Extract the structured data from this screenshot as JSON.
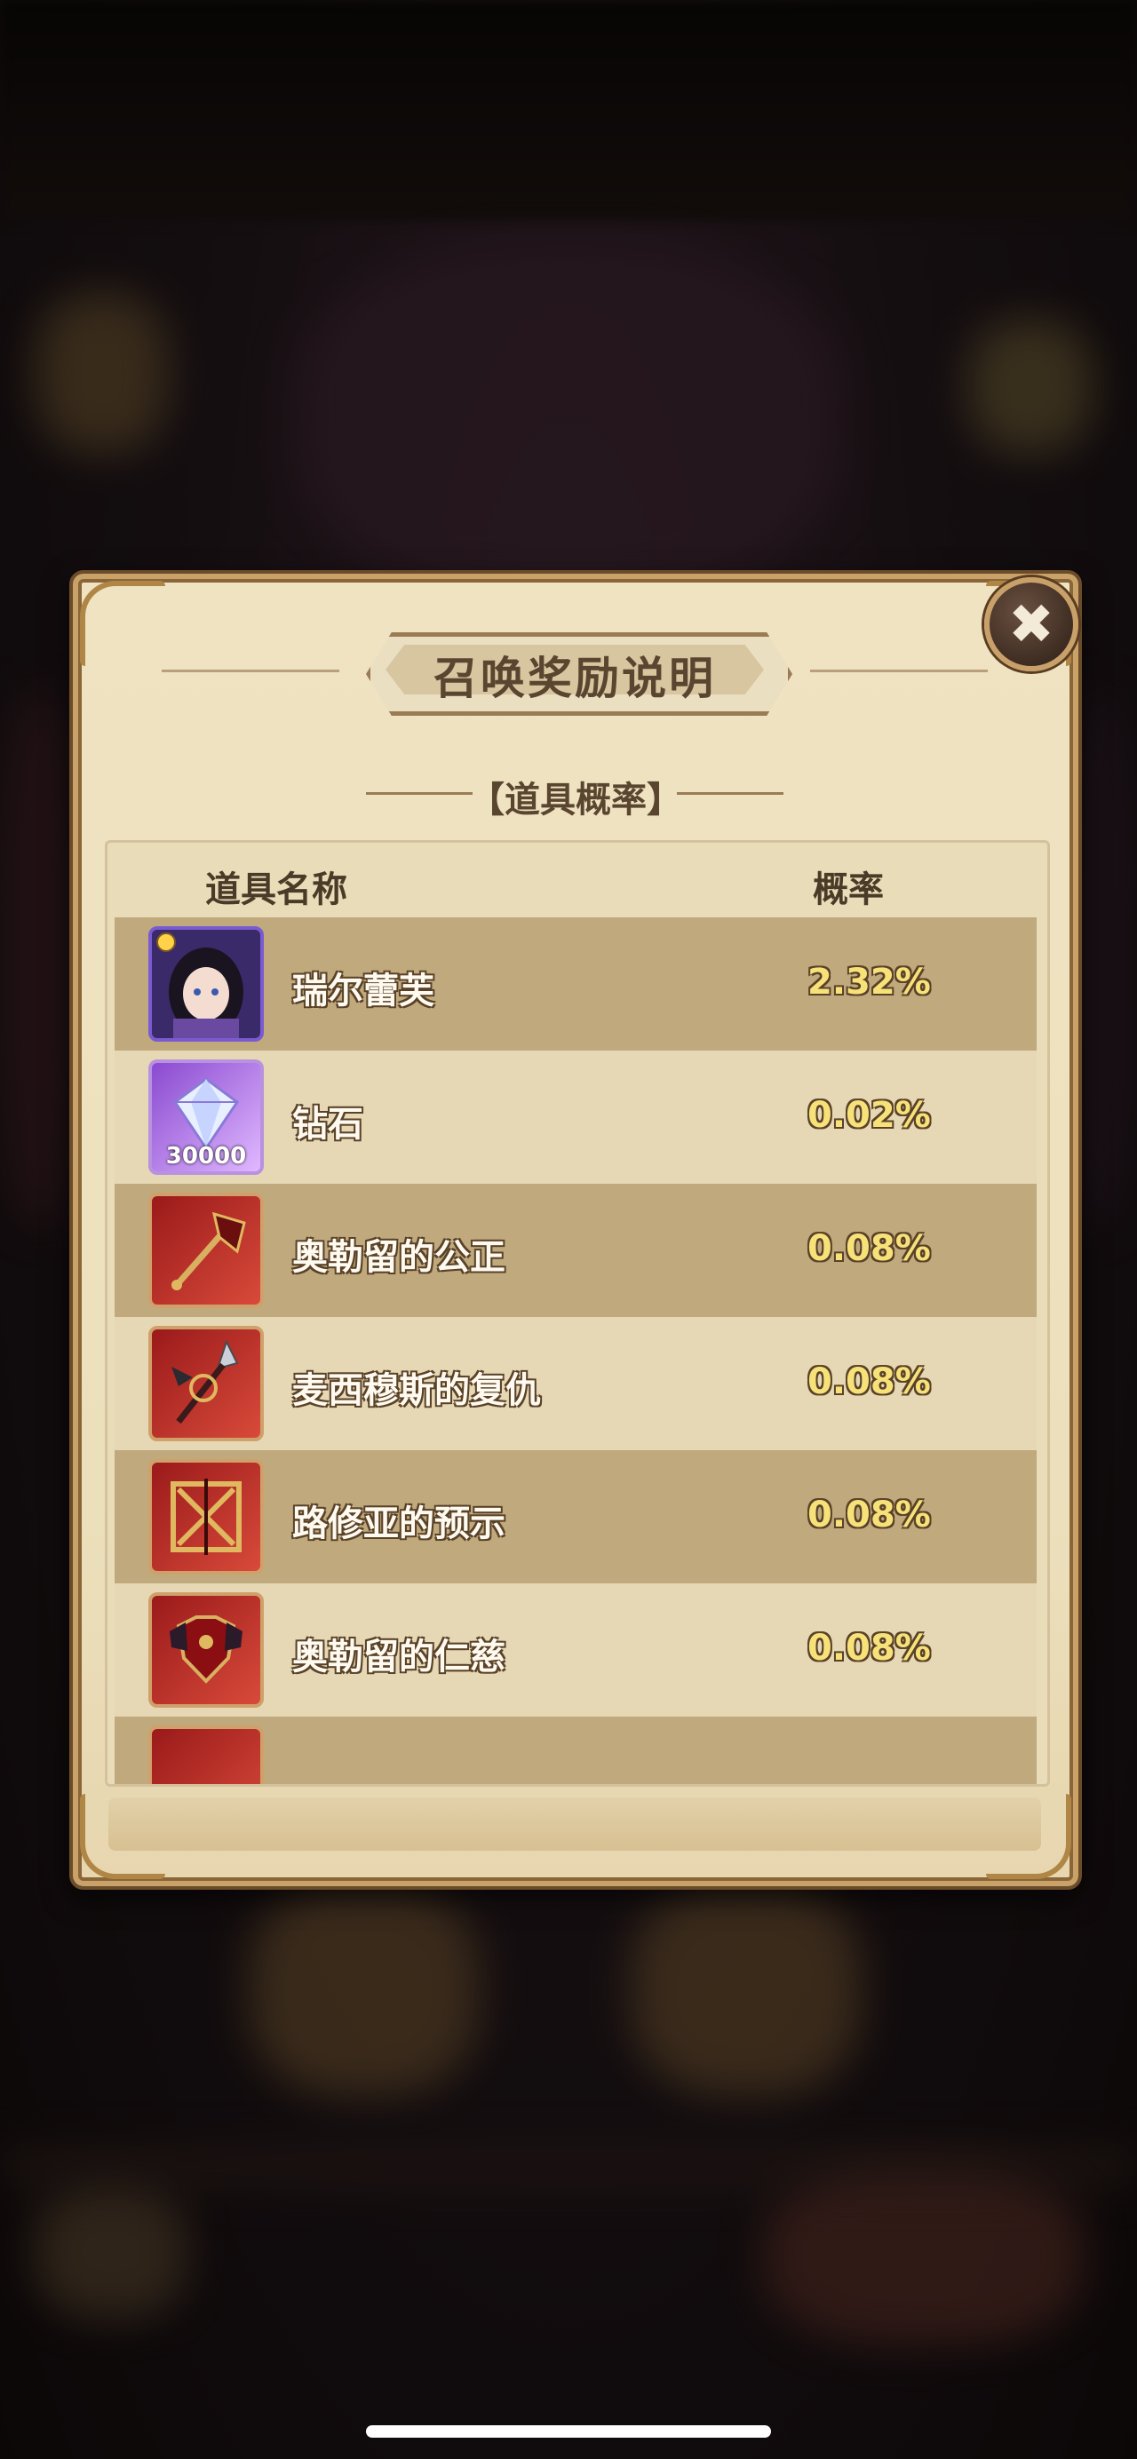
{
  "dialog": {
    "title": "召唤奖励说明",
    "subtitle": "【道具概率】",
    "close_label": "✖"
  },
  "table": {
    "headers": {
      "name": "道具名称",
      "rate": "概率"
    },
    "rows": [
      {
        "name": "瑞尔蕾芙",
        "rate": "2.32%",
        "icon": "hero-portrait-icon"
      },
      {
        "name": "钻石",
        "rate": "0.02%",
        "icon": "diamond-icon",
        "quantity": "30000"
      },
      {
        "name": "奥勒留的公正",
        "rate": "0.08%",
        "icon": "axe-weapon-icon"
      },
      {
        "name": "麦西穆斯的复仇",
        "rate": "0.08%",
        "icon": "spear-weapon-icon"
      },
      {
        "name": "路修亚的预示",
        "rate": "0.08%",
        "icon": "sigil-emblem-icon"
      },
      {
        "name": "奥勒留的仁慈",
        "rate": "0.08%",
        "icon": "armor-icon"
      }
    ]
  },
  "colors": {
    "panel_bg": "#efe3c2",
    "row_dark": "#c1a97e",
    "row_light": "#e6d8b4",
    "rate_text": "#f7e27a"
  }
}
